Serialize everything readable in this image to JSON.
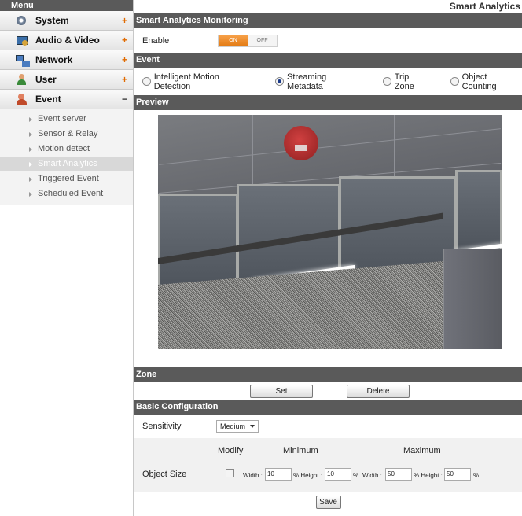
{
  "sidebar": {
    "header": "Menu",
    "items": [
      {
        "label": "System",
        "toggle": "+",
        "icon": "system-icon"
      },
      {
        "label": "Audio & Video",
        "toggle": "+",
        "icon": "audio-video-icon"
      },
      {
        "label": "Network",
        "toggle": "+",
        "icon": "network-icon"
      },
      {
        "label": "User",
        "toggle": "+",
        "icon": "user-icon"
      },
      {
        "label": "Event",
        "toggle": "−",
        "icon": "event-icon"
      }
    ],
    "sub_items": [
      {
        "label": "Event server"
      },
      {
        "label": "Sensor & Relay"
      },
      {
        "label": "Motion detect"
      },
      {
        "label": "Smart Analytics",
        "active": true
      },
      {
        "label": "Triggered Event"
      },
      {
        "label": "Scheduled Event"
      }
    ]
  },
  "page": {
    "title": "Smart Analytics"
  },
  "monitoring": {
    "section_title": "Smart Analytics Monitoring",
    "enable_label": "Enable",
    "on_label": "ON",
    "off_label": "OFF",
    "state": "ON"
  },
  "event": {
    "section_title": "Event",
    "options": [
      {
        "label": "Intelligent Motion Detection",
        "checked": false
      },
      {
        "label": "Streaming Metadata",
        "checked": true
      },
      {
        "label": "Trip Zone",
        "checked": false
      },
      {
        "label": "Object Counting",
        "checked": false
      }
    ]
  },
  "preview": {
    "section_title": "Preview"
  },
  "zone": {
    "section_title": "Zone",
    "set_label": "Set",
    "delete_label": "Delete"
  },
  "basic": {
    "section_title": "Basic Configuration",
    "sensitivity_label": "Sensitivity",
    "sensitivity_value": "Medium",
    "modify_label": "Modify",
    "minimum_label": "Minimum",
    "maximum_label": "Maximum",
    "object_size_label": "Object Size",
    "width_label": "Width :",
    "height_label": "% Height :",
    "percent": "%",
    "min_width": "10",
    "min_height": "10",
    "max_width": "50",
    "max_height": "50",
    "save_label": "Save"
  },
  "colors": {
    "section_bar": "#5a5a5a",
    "toggle_on": "#e27a12"
  }
}
